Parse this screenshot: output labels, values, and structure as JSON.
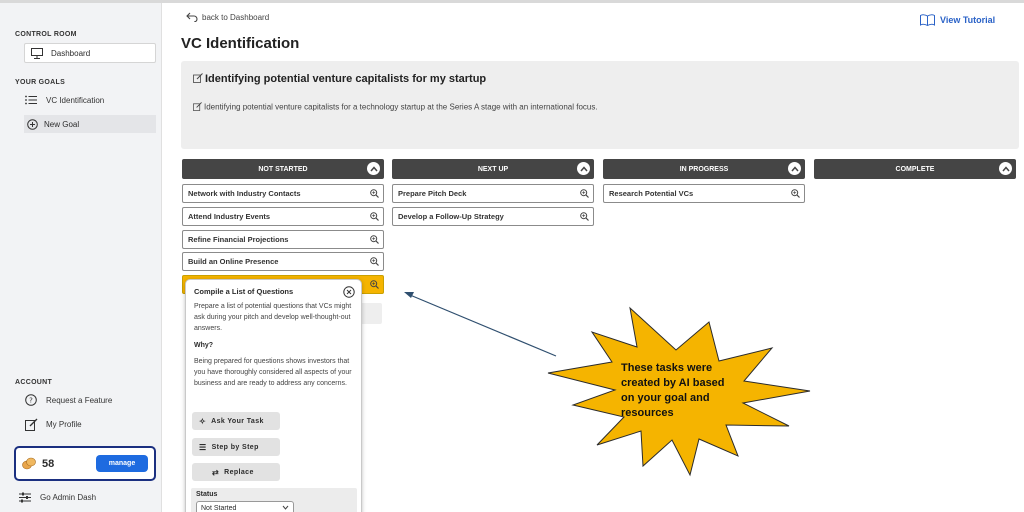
{
  "sidebar": {
    "control_room_label": "CONTROL ROOM",
    "dashboard_label": "Dashboard",
    "your_goals_label": "YOUR GOALS",
    "goal_item_label": "VC Identification",
    "new_goal_label": "New Goal",
    "account_label": "ACCOUNT",
    "request_feature_label": "Request a Feature",
    "my_profile_label": "My Profile",
    "credits_count": "58",
    "manage_label": "manage",
    "admin_dash_label": "Go Admin Dash"
  },
  "header": {
    "back_label": "back to Dashboard",
    "tutorial_label": "View Tutorial",
    "page_title": "VC Identification"
  },
  "goal": {
    "title": "Identifying potential venture capitalists for my startup",
    "description": "Identifying potential venture capitalists for a technology startup at the Series A stage with an international focus."
  },
  "columns": [
    {
      "title": "NOT STARTED",
      "tasks": [
        "Network with Industry Contacts",
        "Attend Industry Events",
        "Refine Financial Projections",
        "Build an Online Presence",
        ""
      ]
    },
    {
      "title": "NEXT UP",
      "tasks": [
        "Prepare Pitch Deck",
        "Develop a Follow-Up Strategy"
      ]
    },
    {
      "title": "IN PROGRESS",
      "tasks": [
        "Research Potential VCs"
      ]
    },
    {
      "title": "COMPLETE",
      "tasks": []
    }
  ],
  "popover": {
    "title": "Compile a List of Questions",
    "description": "Prepare a list of potential questions that VCs might ask during your pitch and develop well-thought-out answers.",
    "why_label": "Why?",
    "why_text": "Being prepared for questions shows investors that you have thoroughly considered all aspects of your business and are ready to address any concerns.",
    "ask_label": "Ask Your Task",
    "step_label": "Step by Step",
    "replace_label": "Replace",
    "status_label": "Status",
    "status_value": "Not Started"
  },
  "callout": {
    "text": "These tasks were created by AI based on your goal and resources"
  },
  "colors": {
    "accent_blue": "#1e6be0",
    "highlight_yellow": "#f5b400",
    "column_header": "#454545",
    "star_fill": "#f5b400"
  }
}
